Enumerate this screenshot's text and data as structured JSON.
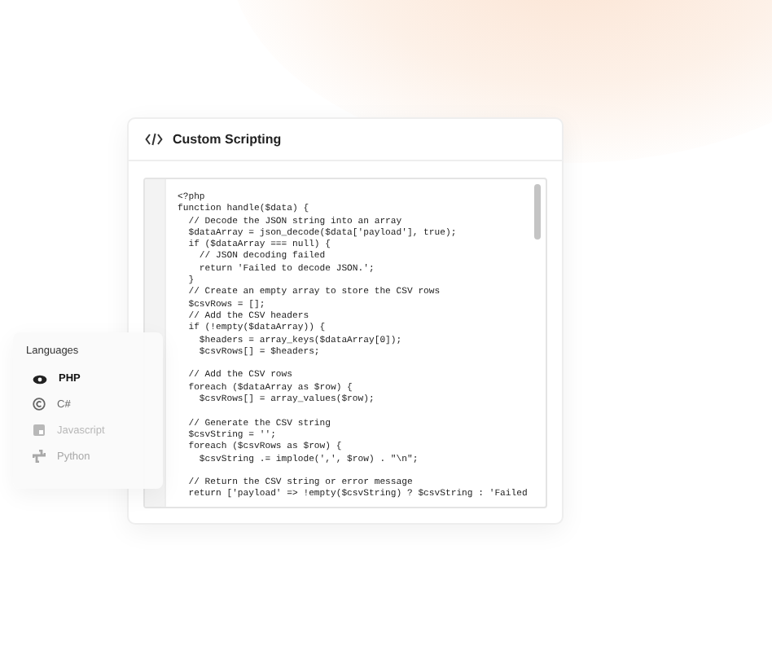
{
  "editor": {
    "title": "Custom Scripting",
    "lines": [
      {
        "text": "<?php"
      },
      {
        "text": "function handle($data) {"
      },
      {
        "text": "  // Decode the JSON string into an array"
      },
      {
        "text": "  $dataArray = json_decode($data['payload'], true);"
      },
      {
        "text": "  if ($dataArray === null) {"
      },
      {
        "text": "    // JSON decoding failed"
      },
      {
        "text": "    return 'Failed to decode JSON.';"
      },
      {
        "text": "  }"
      },
      {
        "text": "  // Create an empty array to store the CSV rows"
      },
      {
        "text": "  $csvRows = [];"
      },
      {
        "text": "  // Add the CSV headers"
      },
      {
        "text": "  if (!empty($dataArray)) {"
      },
      {
        "text": "    $headers = array_keys($dataArray[0]);"
      },
      {
        "text": "    $csvRows[] = $headers;"
      },
      {
        "text": "  // Add the CSV rows",
        "gap_before": true
      },
      {
        "text": "  foreach ($dataArray as $row) {"
      },
      {
        "text": "    $csvRows[] = array_values($row);"
      },
      {
        "text": "  // Generate the CSV string",
        "gap_before": true
      },
      {
        "text": "  $csvString = '';"
      },
      {
        "text": "  foreach ($csvRows as $row) {"
      },
      {
        "text": "    $csvString .= implode(',', $row) . \"\\n\";"
      },
      {
        "text": "  // Return the CSV string or error message",
        "gap_before": true
      },
      {
        "text": "  return ['payload' => !empty($csvString) ? $csvString : 'Failed"
      }
    ]
  },
  "languages": {
    "title": "Languages",
    "items": [
      {
        "label": "PHP",
        "kind": "eye",
        "selected": true,
        "disabled": false
      },
      {
        "label": "C#",
        "kind": "c",
        "selected": false,
        "disabled": false
      },
      {
        "label": "Javascript",
        "kind": "square",
        "selected": false,
        "disabled": true
      },
      {
        "label": "Python",
        "kind": "snake",
        "selected": false,
        "disabled": true
      }
    ]
  }
}
